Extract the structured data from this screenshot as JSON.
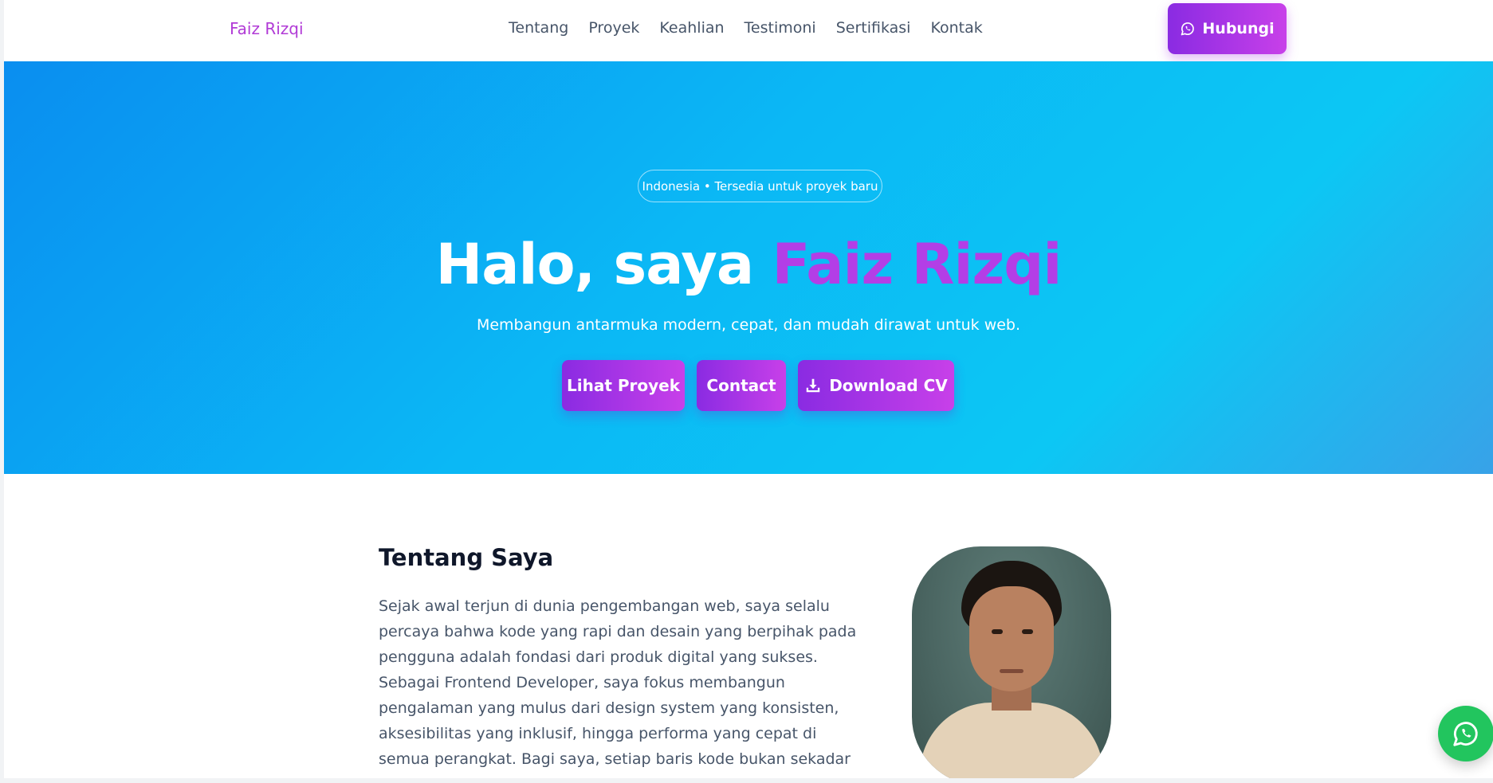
{
  "nav": {
    "brand": "Faiz Rizqi",
    "items": [
      {
        "label": "Tentang"
      },
      {
        "label": "Proyek"
      },
      {
        "label": "Keahlian"
      },
      {
        "label": "Testimoni"
      },
      {
        "label": "Sertifikasi"
      },
      {
        "label": "Kontak"
      }
    ],
    "cta_label": "Hubungi",
    "cta_icon": "whatsapp-icon"
  },
  "hero": {
    "badge": "Indonesia • Tersedia untuk proyek baru",
    "title_prefix": "Halo, saya ",
    "title_name": "Faiz Rizqi",
    "subtitle": "Membangun antarmuka modern, cepat, dan mudah dirawat untuk web.",
    "buttons": {
      "projects": "Lihat Proyek",
      "contact": "Contact",
      "cv": "Download CV"
    },
    "cv_icon": "download-icon"
  },
  "about": {
    "title": "Tentang Saya",
    "text": "Sejak awal terjun di dunia pengembangan web, saya selalu percaya bahwa kode yang rapi dan desain yang berpihak pada pengguna adalah fondasi dari produk digital yang sukses. Sebagai Frontend Developer, saya fokus membangun pengalaman yang mulus dari design system yang konsisten, aksesibilitas yang inklusif, hingga performa yang cepat di semua perangkat. Bagi saya, setiap baris kode bukan sekadar instruksi untuk mesin, tapi juga jembatan"
  },
  "floating": {
    "icon": "whatsapp-icon"
  },
  "colors": {
    "accent": "#b33ee6",
    "brand": "#b13bd6",
    "button_from": "#8a2be2",
    "button_to": "#c840e9",
    "hero_from": "#0a8ef0",
    "hero_to": "#0cc7f4",
    "whatsapp": "#22c55e"
  }
}
